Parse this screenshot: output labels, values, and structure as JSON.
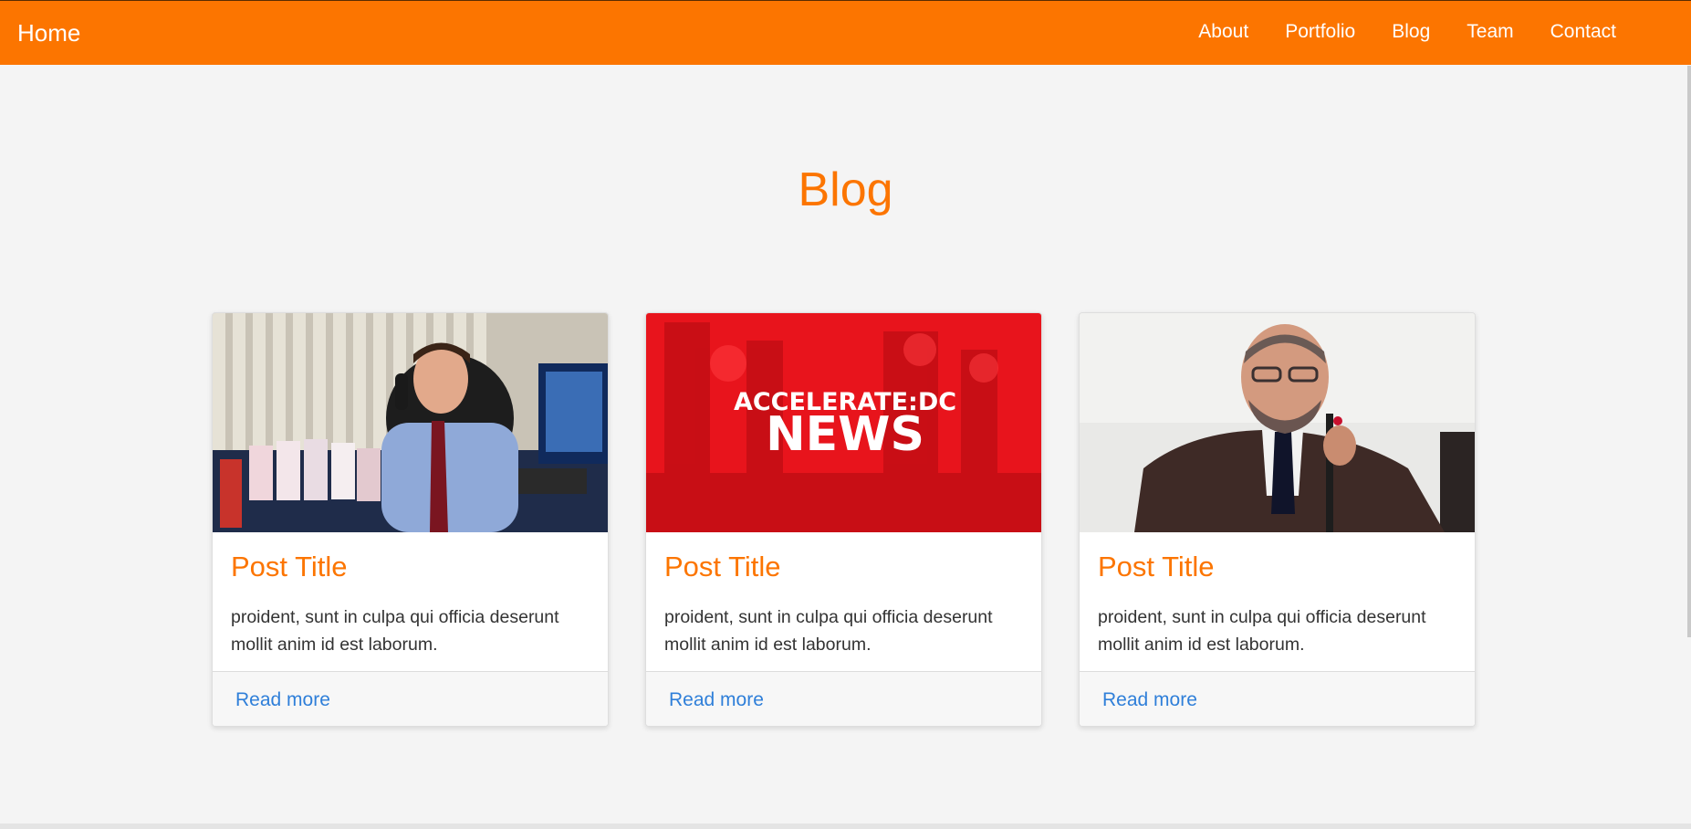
{
  "navbar": {
    "brand": "Home",
    "links": [
      "About",
      "Portfolio",
      "Blog",
      "Team",
      "Contact"
    ]
  },
  "section": {
    "title": "Blog"
  },
  "cards": [
    {
      "title": "Post Title",
      "text": "proident, sunt in culpa qui officia deserunt mollit anim id est laborum.",
      "link": "Read more",
      "image": "photo-man-on-phone"
    },
    {
      "title": "Post Title",
      "text": "proident, sunt in culpa qui officia deserunt mollit anim id est laborum.",
      "link": "Read more",
      "image": "accelerate-dc-news-banner",
      "image_text": {
        "line1": "ACCELERATE",
        "sep": ":",
        "line1b": "DC",
        "line2": "NEWS"
      }
    },
    {
      "title": "Post Title",
      "text": "proident, sunt in culpa qui officia deserunt mollit anim id est laborum.",
      "link": "Read more",
      "image": "photo-man-with-microphone"
    }
  ],
  "colors": {
    "accent": "#fc7500",
    "link": "#2f7fd9",
    "background": "#f4f4f4"
  }
}
